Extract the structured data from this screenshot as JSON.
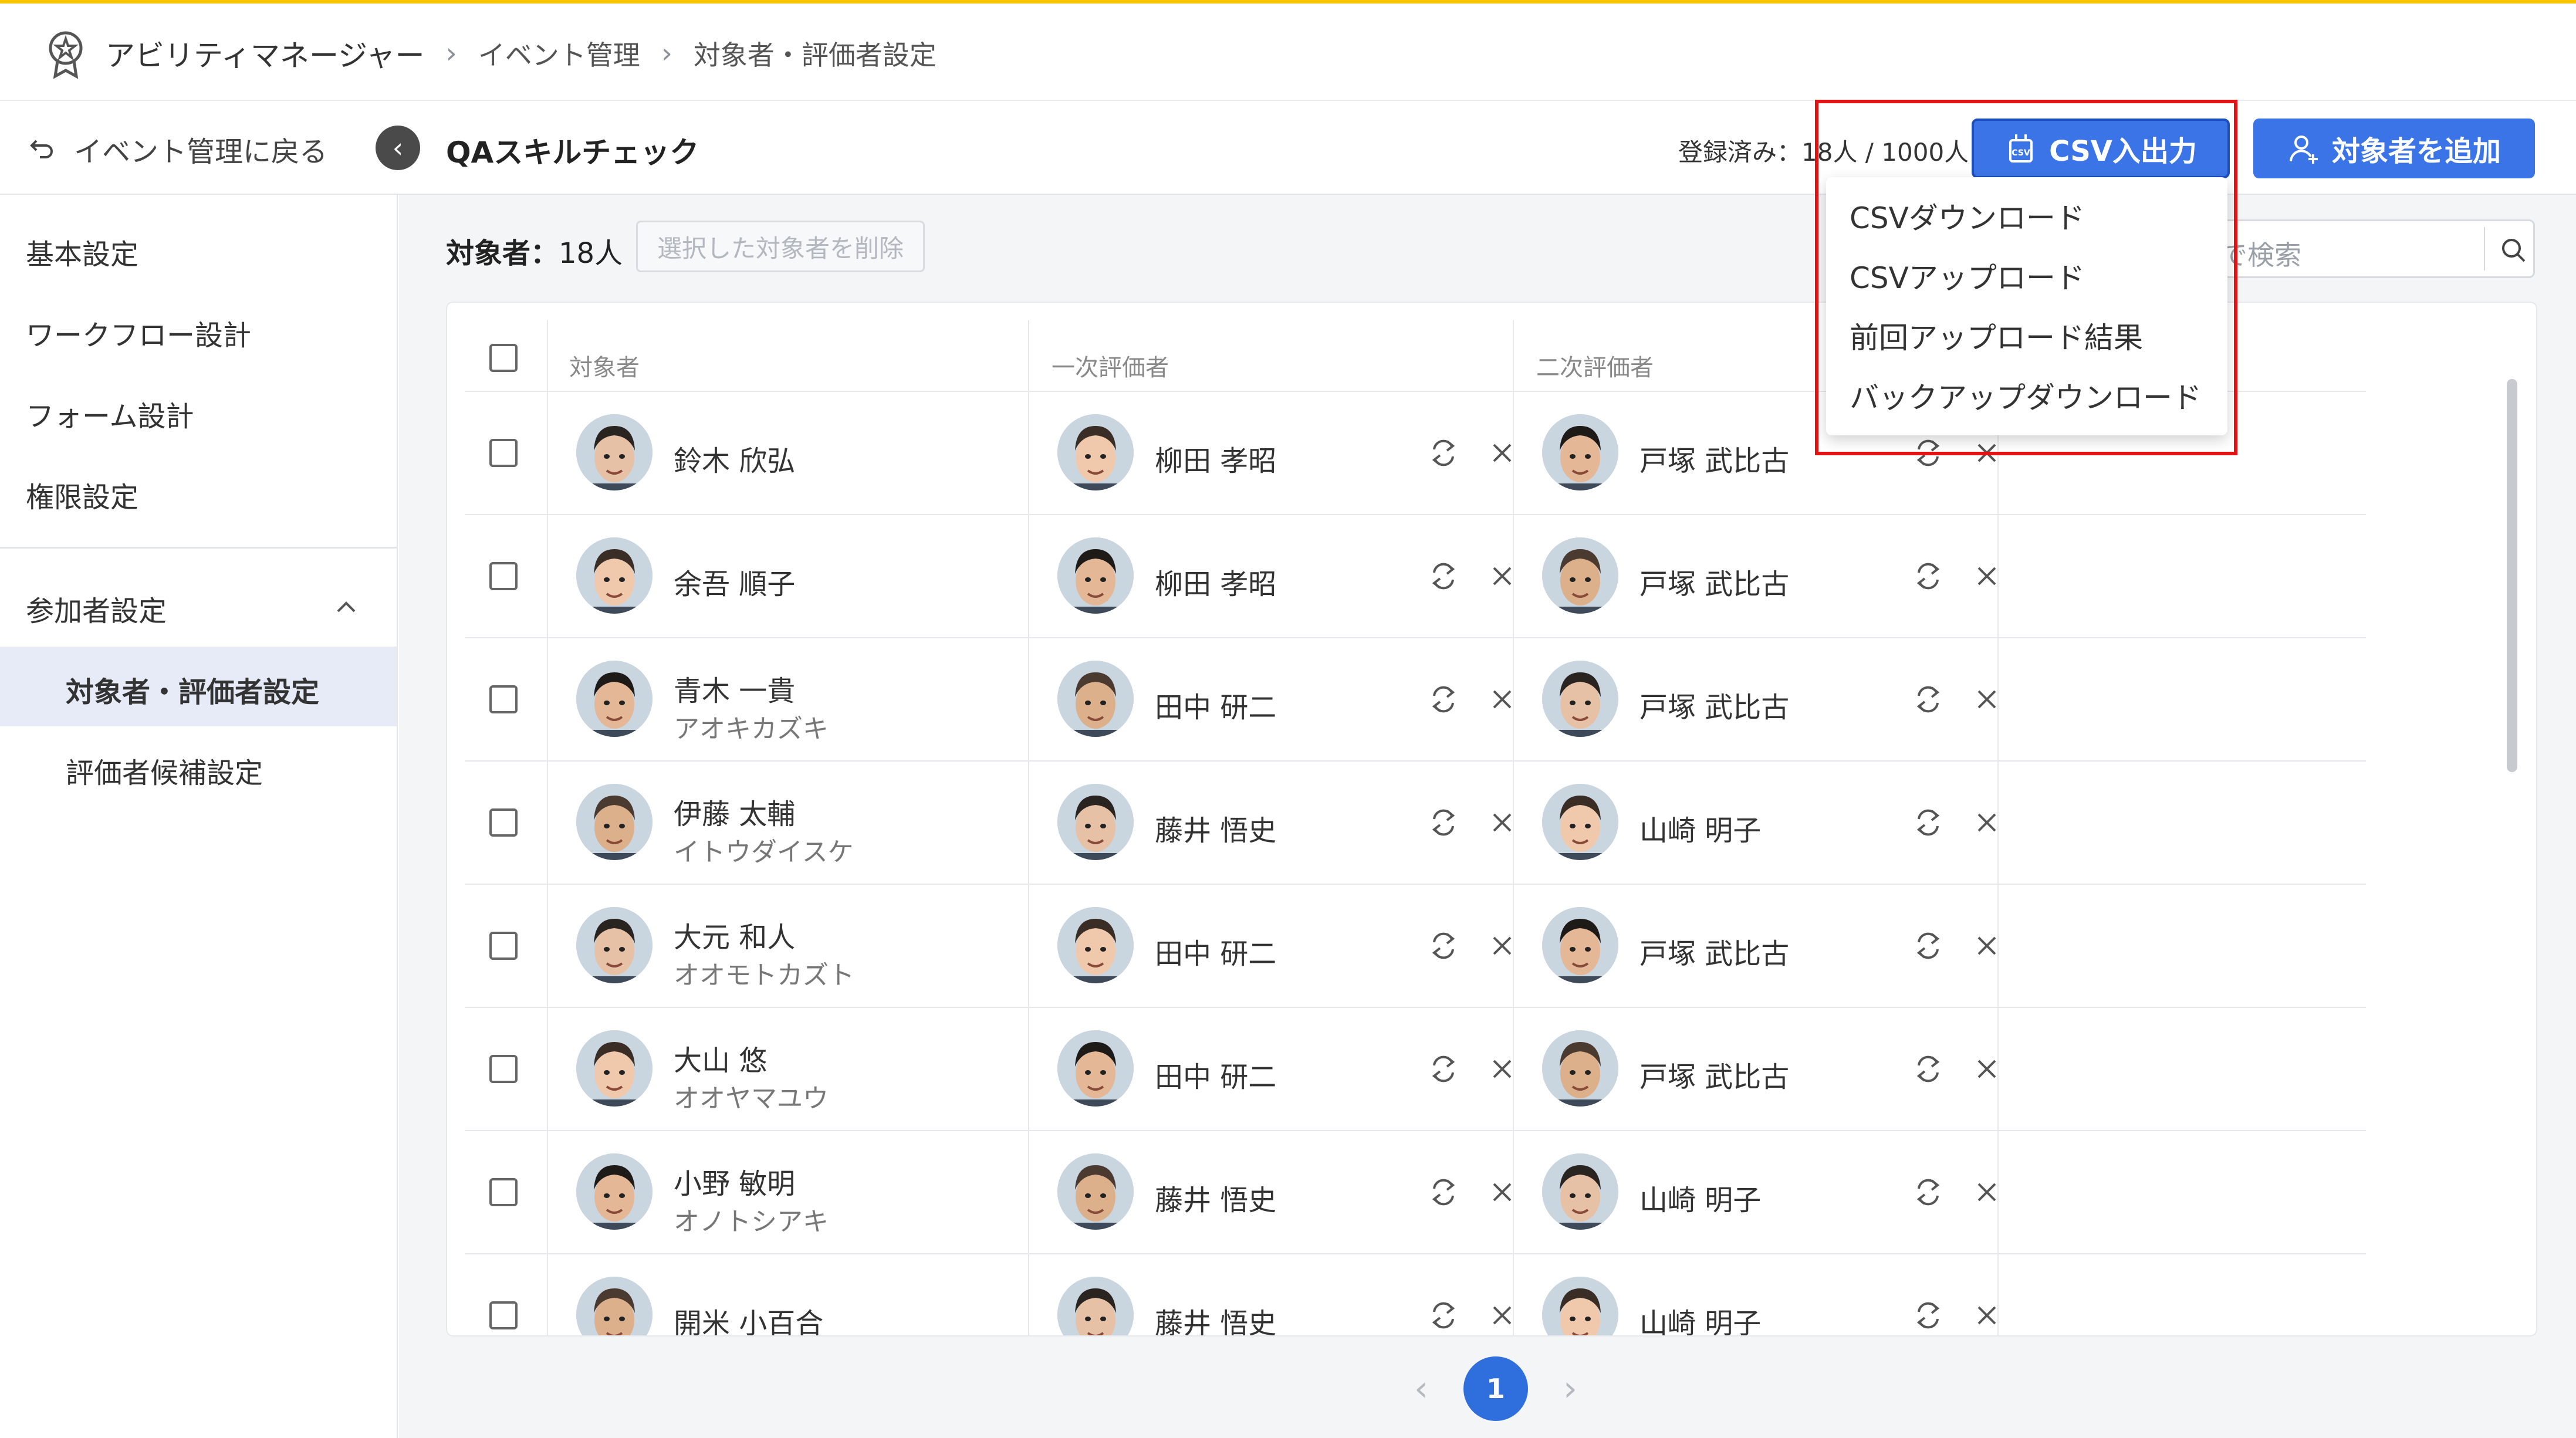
{
  "breadcrumb": {
    "app": "アビリティマネージャー",
    "items": [
      "イベント管理",
      "対象者・評価者設定"
    ]
  },
  "header": {
    "back_label": "イベント管理に戻る",
    "event_title": "QAスキルチェック",
    "registered": "登録済み：18人 / 1000人",
    "csv_button": "CSV入出力",
    "add_button": "対象者を追加"
  },
  "sidebar": {
    "items": [
      "基本設定",
      "ワークフロー設計",
      "フォーム設計",
      "権限設定"
    ],
    "group": "参加者設定",
    "sub_items": [
      "対象者・評価者設定",
      "評価者候補設定"
    ]
  },
  "main": {
    "count_label": "対象者：",
    "count_value": "18人",
    "delete_button": "選択した対象者を削除",
    "search_placeholder": "名で検索"
  },
  "table": {
    "headers": [
      "対象者",
      "一次評価者",
      "二次評価者"
    ],
    "rows": [
      {
        "name": "鈴木 欣弘",
        "kana": "",
        "first": "柳田 孝昭",
        "second": "戸塚 武比古"
      },
      {
        "name": "余吾 順子",
        "kana": "",
        "first": "柳田 孝昭",
        "second": "戸塚 武比古"
      },
      {
        "name": "青木 一貴",
        "kana": "アオキカズキ",
        "first": "田中 研二",
        "second": "戸塚 武比古"
      },
      {
        "name": "伊藤 太輔",
        "kana": "イトウダイスケ",
        "first": "藤井 悟史",
        "second": "山崎 明子"
      },
      {
        "name": "大元 和人",
        "kana": "オオモトカズト",
        "first": "田中 研二",
        "second": "戸塚 武比古"
      },
      {
        "name": "大山 悠",
        "kana": "オオヤマユウ",
        "first": "田中 研二",
        "second": "戸塚 武比古"
      },
      {
        "name": "小野 敏明",
        "kana": "オノトシアキ",
        "first": "藤井 悟史",
        "second": "山崎 明子"
      },
      {
        "name": "開米 小百合",
        "kana": "",
        "first": "藤井 悟史",
        "second": "山崎 明子"
      }
    ]
  },
  "csv_menu": {
    "items": [
      "CSVダウンロード",
      "CSVアップロード",
      "前回アップロード結果",
      "バックアップダウンロード"
    ]
  },
  "pagination": {
    "current": "1"
  },
  "colors": {
    "accent": "#3b74e6",
    "top_border": "#f7c600",
    "highlight_box": "#e01414"
  }
}
